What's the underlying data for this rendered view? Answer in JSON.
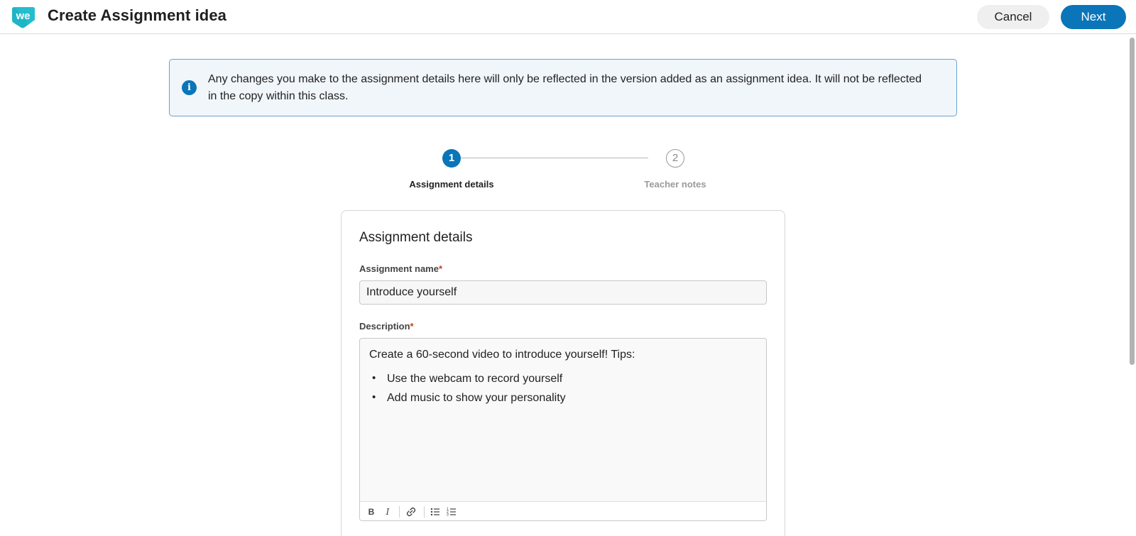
{
  "header": {
    "logo_text": "we",
    "title": "Create Assignment idea",
    "cancel_label": "Cancel",
    "next_label": "Next"
  },
  "banner": {
    "icon": "info-icon",
    "icon_glyph": "i",
    "text": "Any changes you make to the assignment details here will only be reflected in the version added as an assignment idea. It will not be reflected in the copy within this class."
  },
  "stepper": {
    "steps": [
      {
        "number": "1",
        "label": "Assignment details",
        "state": "active"
      },
      {
        "number": "2",
        "label": "Teacher notes",
        "state": "inactive"
      }
    ]
  },
  "form": {
    "card_title": "Assignment details",
    "name_label": "Assignment name",
    "required_mark": "*",
    "name_value": "Introduce yourself",
    "description_label": "Description",
    "description_intro": "Create a 60-second video to introduce yourself! Tips:",
    "description_bullets": [
      "Use the webcam to record yourself",
      "Add music to show your personality"
    ],
    "toolbar": {
      "bold": "B",
      "italic": "I",
      "link_icon": "link-icon",
      "bullet_list_icon": "bulleted-list-icon",
      "numbered_list_icon": "numbered-list-icon"
    }
  },
  "colors": {
    "accent": "#0a75b9",
    "banner_bg": "#f1f6fb",
    "banner_border": "#6aa0cf",
    "required": "#c7411b"
  }
}
